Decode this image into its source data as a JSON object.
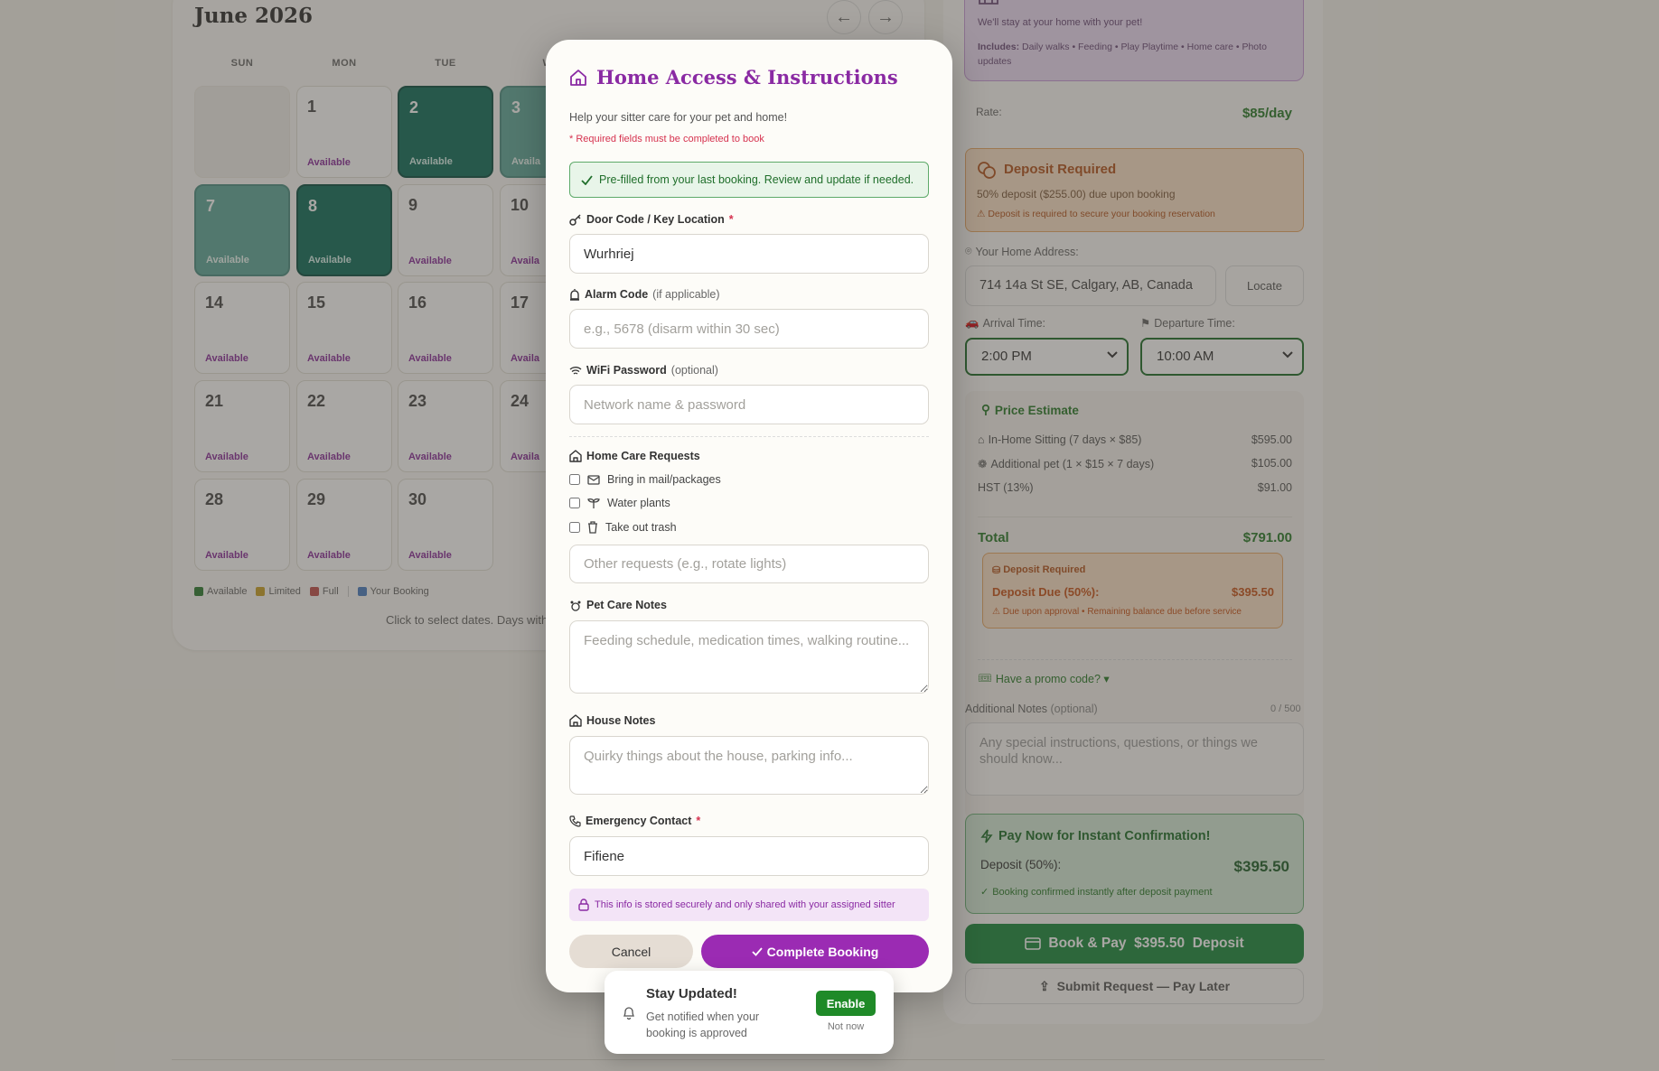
{
  "calendar": {
    "title": "June 2026",
    "prev_icon": "←",
    "next_icon": "→",
    "weekdays": [
      "SUN",
      "MON",
      "TUE",
      "W"
    ],
    "days": [
      {
        "num": "1",
        "status": "Available"
      },
      {
        "num": "2",
        "status": "Available"
      },
      {
        "num": "3",
        "status": "Availa"
      },
      {
        "num": "7",
        "status": "Available"
      },
      {
        "num": "8",
        "status": "Available"
      },
      {
        "num": "9",
        "status": "Available"
      },
      {
        "num": "10",
        "status": "Availa"
      },
      {
        "num": "14",
        "status": "Available"
      },
      {
        "num": "15",
        "status": "Available"
      },
      {
        "num": "16",
        "status": "Available"
      },
      {
        "num": "17",
        "status": "Availa"
      },
      {
        "num": "21",
        "status": "Available"
      },
      {
        "num": "22",
        "status": "Available"
      },
      {
        "num": "23",
        "status": "Available"
      },
      {
        "num": "24",
        "status": "Availa"
      },
      {
        "num": "28",
        "status": "Available"
      },
      {
        "num": "29",
        "status": "Available"
      },
      {
        "num": "30",
        "status": "Available"
      }
    ],
    "legend": {
      "available": "Available",
      "limited": "Limited",
      "full": "Full",
      "your_booking": "Your Booking"
    },
    "legend_colors": {
      "available": "#2e7d32",
      "limited": "#c9a227",
      "full": "#c0504d",
      "your_booking": "#4a7ec2"
    },
    "hint": "Click to select dates. Days with"
  },
  "service": {
    "description": "We'll stay at your home with your pet!",
    "includes_label": "Includes:",
    "includes": "Daily walks • Feeding • Play Playtime • Home care • Photo updates"
  },
  "rate": {
    "label": "Rate:",
    "value": "$85/day"
  },
  "deposit_notice": {
    "title": "Deposit Required",
    "description": "50% deposit ($255.00) due upon booking",
    "warning": "Deposit is required to secure your booking reservation"
  },
  "address": {
    "label": "Your Home Address:",
    "value": "714 14a St SE, Calgary, AB, Canada",
    "locate_label": "Locate"
  },
  "times": {
    "arrival_label": "Arrival Time:",
    "arrival_value": "2:00 PM",
    "departure_label": "Departure Time:",
    "departure_value": "10:00 AM"
  },
  "price_estimate": {
    "title": "Price Estimate",
    "lines": [
      {
        "label": "In-Home Sitting (7 days × $85)",
        "amount": "$595.00"
      },
      {
        "label": "Additional pet (1 × $15 × 7 days)",
        "amount": "$105.00"
      },
      {
        "label": "HST (13%)",
        "amount": "$91.00"
      }
    ],
    "total_label": "Total",
    "total_value": "$791.00",
    "deposit_title": "Deposit Required",
    "deposit_due_label": "Deposit Due (50%):",
    "deposit_due_value": "$395.50",
    "deposit_note": "Due upon approval • Remaining balance due before service",
    "promo_label": "Have a promo code? ▾"
  },
  "additional_notes": {
    "label": "Additional Notes",
    "optional": "(optional)",
    "counter": "0 / 500",
    "placeholder": "Any special instructions, questions, or things we should know..."
  },
  "pay_now": {
    "title": "Pay Now for Instant Confirmation!",
    "deposit_label": "Deposit (50%):",
    "deposit_value": "$395.50",
    "subtitle": "Booking confirmed instantly after deposit payment"
  },
  "book_pay_label": "Book & Pay  $395.50  Deposit",
  "pay_later_label": "Submit Request — Pay Later",
  "modal": {
    "title": "Home Access & Instructions",
    "subtitle": "Help your sitter care for your pet and home!",
    "required_note": "* Required fields must be completed to book",
    "prefill_notice": "Pre-filled from your last booking. Review and update if needed.",
    "door_code": {
      "label": "Door Code / Key Location",
      "required": "*",
      "value": "Wurhriej"
    },
    "alarm_code": {
      "label": "Alarm Code",
      "optional": "(if applicable)",
      "placeholder": "e.g., 5678 (disarm within 30 sec)"
    },
    "wifi": {
      "label": "WiFi Password",
      "optional": "(optional)",
      "placeholder": "Network name & password"
    },
    "home_care": {
      "label": "Home Care Requests",
      "options": [
        "Bring in mail/packages",
        "Water plants",
        "Take out trash"
      ],
      "other_placeholder": "Other requests (e.g., rotate lights)"
    },
    "pet_care": {
      "label": "Pet Care Notes",
      "placeholder": "Feeding schedule, medication times, walking routine..."
    },
    "house_notes": {
      "label": "House Notes",
      "placeholder": "Quirky things about the house, parking info..."
    },
    "emergency": {
      "label": "Emergency Contact",
      "required": "*",
      "value": "Fifiene"
    },
    "secure_note": "This info is stored securely and only shared with your assigned sitter",
    "cancel_label": "Cancel",
    "complete_label": "Complete Booking"
  },
  "toast": {
    "title": "Stay Updated!",
    "body": "Get notified when your booking is approved",
    "enable_label": "Enable",
    "later_label": "Not now"
  },
  "colors": {
    "accent_purple": "#9b2bb3",
    "accent_green": "#1b8a3e",
    "selected_day": "#0f6d5c",
    "warning_orange": "#b3541e"
  }
}
